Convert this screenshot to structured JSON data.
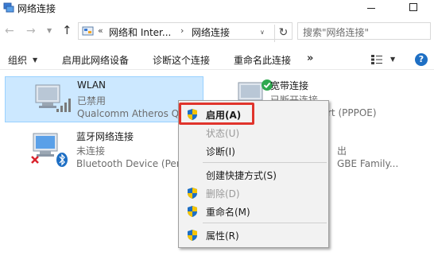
{
  "window": {
    "title": "网络连接"
  },
  "nav": {
    "crumbs": [
      "网络和 Inter...",
      "网络连接"
    ],
    "search_placeholder": "搜索\"网络连接\""
  },
  "toolbar": {
    "organize": "组织",
    "enable_device": "启用此网络设备",
    "diagnose": "诊断这个连接",
    "rename": "重命名此连接",
    "more": "»"
  },
  "items": {
    "wlan": {
      "name": "WLAN",
      "status": "已禁用",
      "device": "Qualcomm Atheros Q"
    },
    "broadband": {
      "name": "宽带连接",
      "status": "已断开连接",
      "device": "rt (PPPOE)"
    },
    "bluetooth": {
      "name": "蓝牙网络连接",
      "status": "未连接",
      "device": "Bluetooth Device (Per"
    },
    "ethernet": {
      "status": "出",
      "device": "GBE Family..."
    }
  },
  "context_menu": {
    "enable": "启用(A)",
    "status": "状态(U)",
    "diagnose": "诊断(I)",
    "create_shortcut": "创建快捷方式(S)",
    "delete": "删除(D)",
    "rename": "重命名(M)",
    "properties": "属性(R)"
  },
  "colors": {
    "selection": "#cce8ff",
    "highlight_border": "#e0342c",
    "shield_blue": "#1e6fc4",
    "shield_yellow": "#f5c400"
  }
}
